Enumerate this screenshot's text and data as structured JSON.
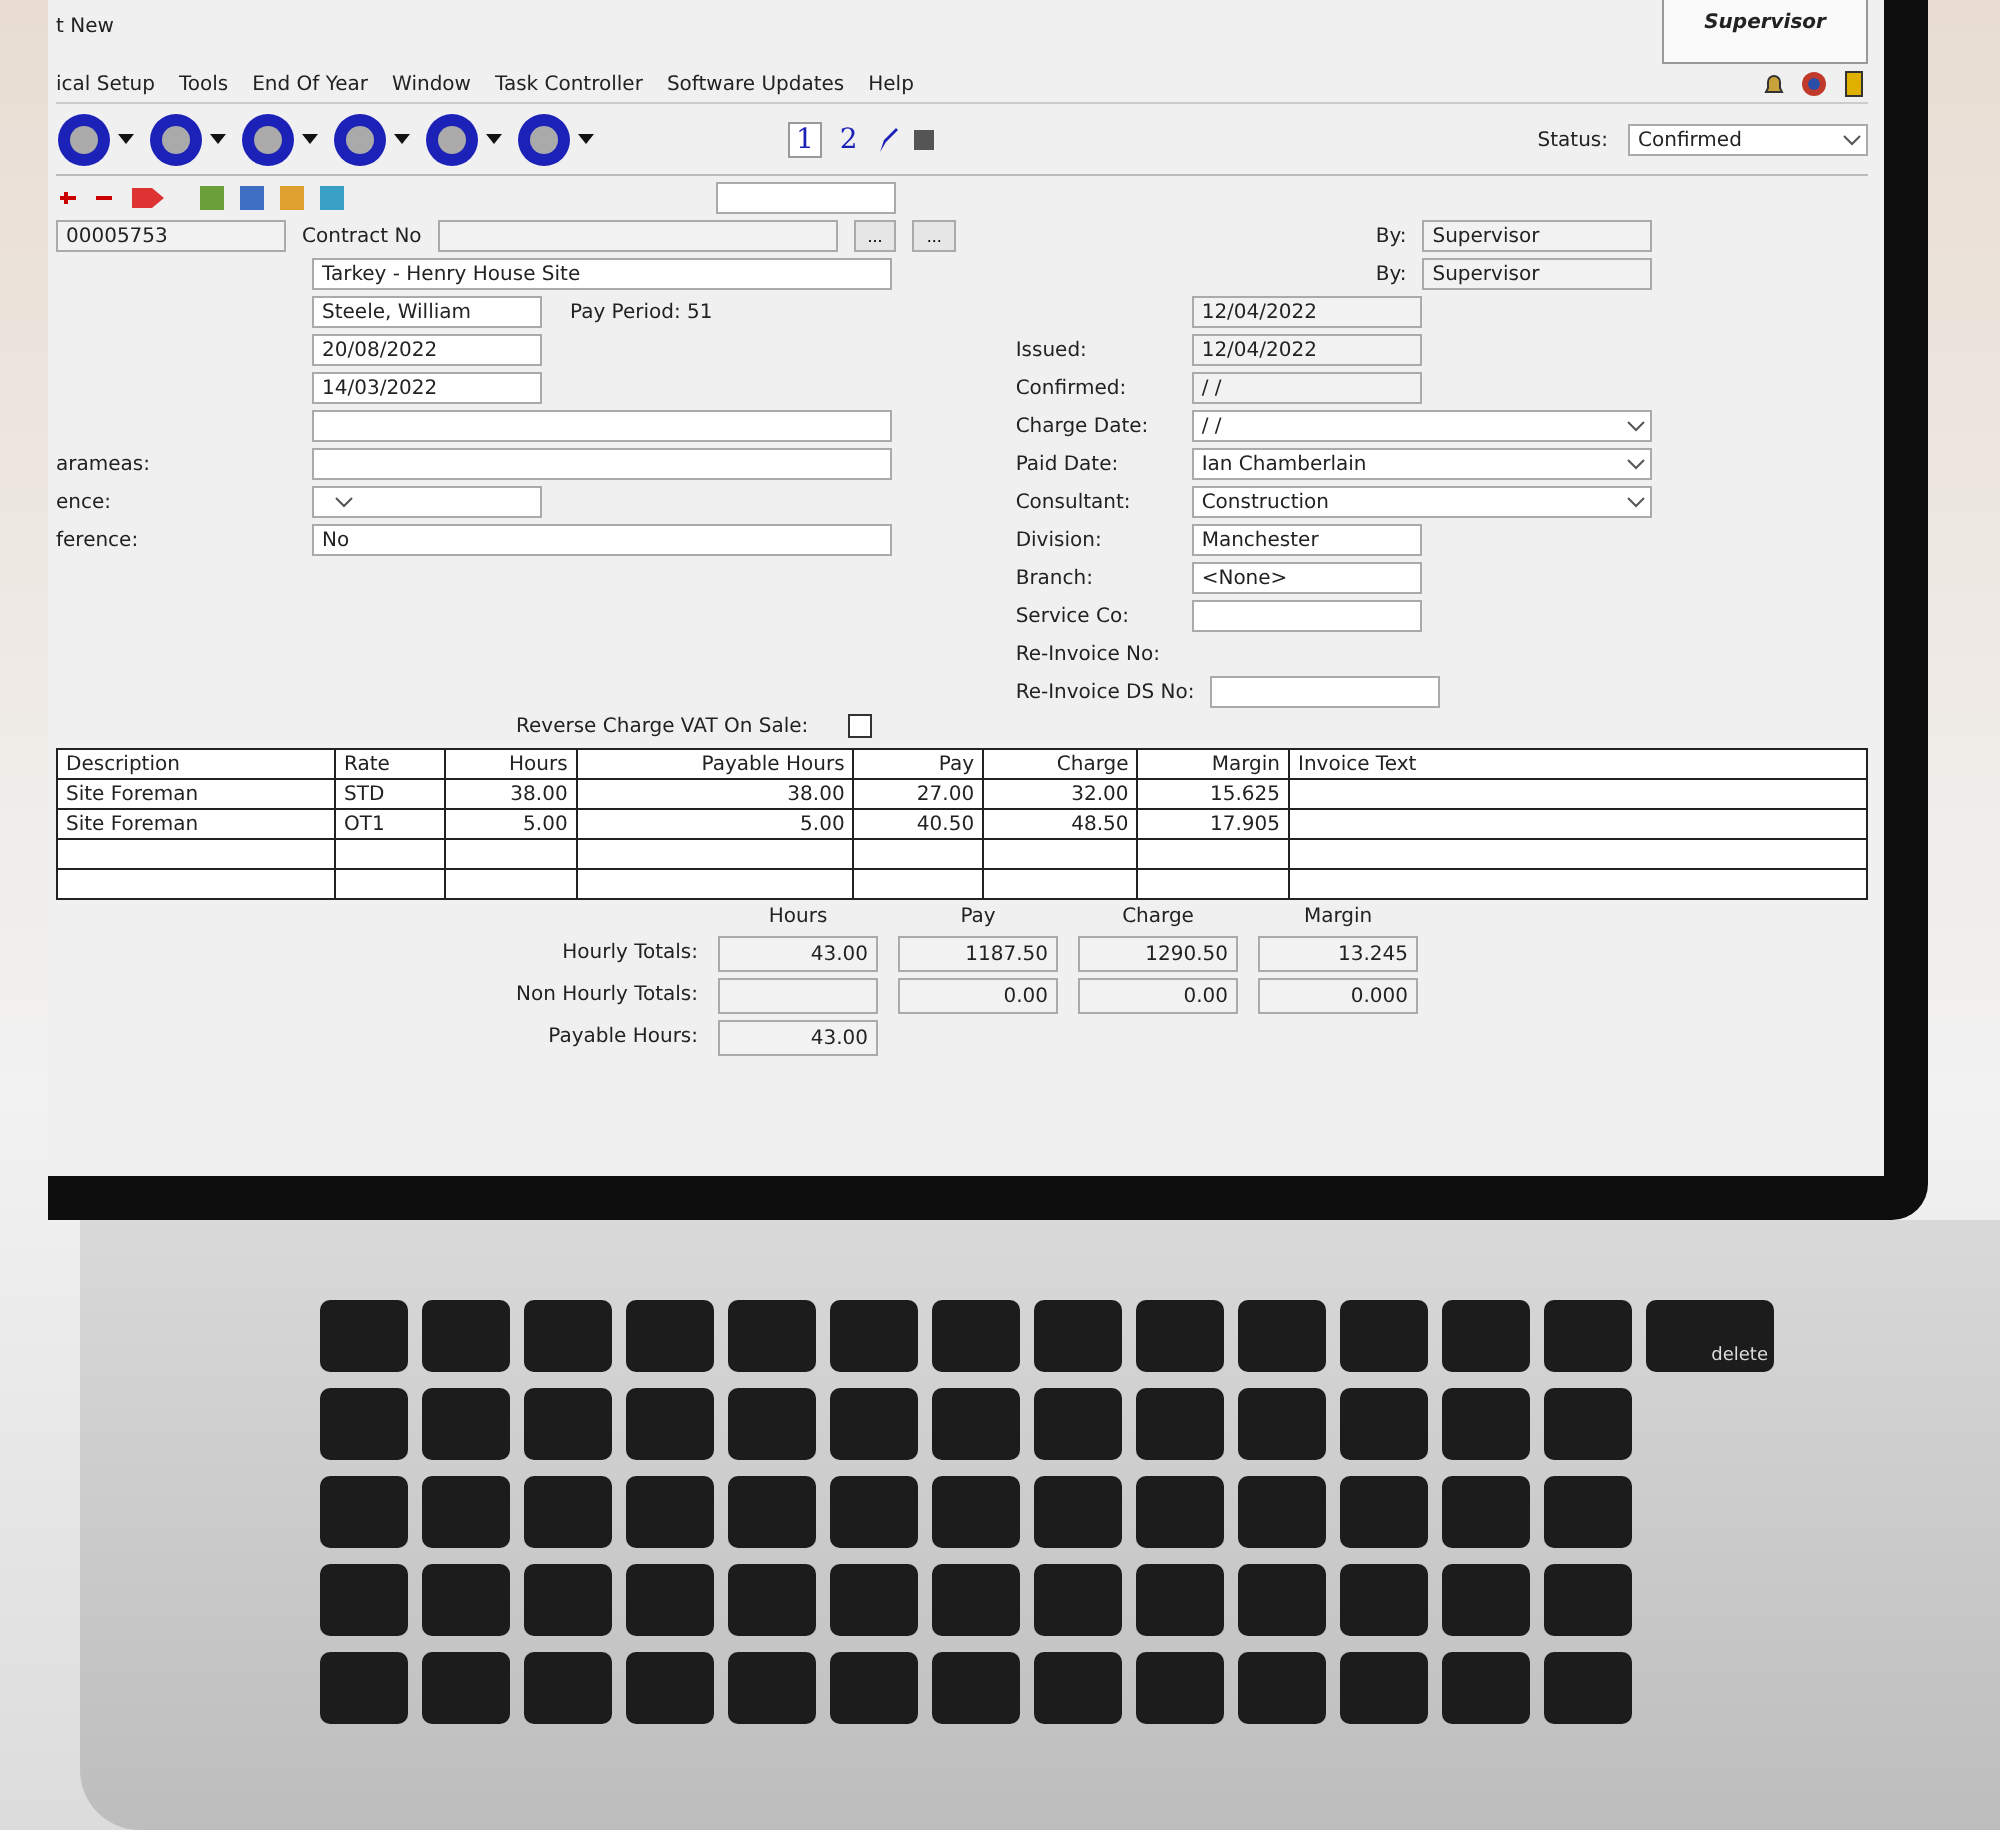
{
  "header": {
    "user": "Supervisor"
  },
  "title_fragment": "t New",
  "menu": [
    "ical Setup",
    "Tools",
    "End Of Year",
    "Window",
    "Task Controller",
    "Software Updates",
    "Help"
  ],
  "pages": [
    {
      "label": "1",
      "selected": true
    },
    {
      "label": "2",
      "selected": false
    }
  ],
  "status": {
    "label": "Status:",
    "value": "Confirmed"
  },
  "by": [
    {
      "label": "By:",
      "value": "Supervisor"
    },
    {
      "label": "By:",
      "value": "Supervisor"
    }
  ],
  "contract": {
    "label": "Contract No",
    "number": "00005753",
    "browse_buttons": [
      "...",
      "..."
    ]
  },
  "left_fields": [
    {
      "value": "Tarkey - Henry House Site",
      "kind": "text"
    },
    {
      "value": "Steele, William",
      "kind": "short",
      "note": "Pay Period: 51"
    },
    {
      "value": "20/08/2022",
      "kind": "short"
    },
    {
      "value": "14/03/2022",
      "kind": "short"
    },
    {
      "kind": "text"
    },
    {
      "label": "arameas:",
      "kind": "text"
    },
    {
      "label": "ence:",
      "kind": "select"
    },
    {
      "label": "ference:",
      "value": "No",
      "kind": "text"
    }
  ],
  "right_fields": [
    {
      "value": "12/04/2022",
      "kind": "readonly"
    },
    {
      "label": "Issued:",
      "value": "12/04/2022",
      "kind": "readonly"
    },
    {
      "label": "Confirmed:",
      "value": "/ /",
      "kind": "readonly"
    },
    {
      "label": "Charge Date:",
      "value": "/ /",
      "kind": "select"
    },
    {
      "label": "Paid Date:",
      "value": "Ian Chamberlain",
      "kind": "select"
    },
    {
      "label": "Consultant:",
      "value": "Construction",
      "kind": "select"
    },
    {
      "label": "Division:",
      "value": "Manchester",
      "kind": "text"
    },
    {
      "label": "Branch:",
      "value": "<None>",
      "kind": "text"
    },
    {
      "label": "Service Co:",
      "kind": "text"
    },
    {
      "label": "Re-Invoice No:",
      "kind": "none"
    }
  ],
  "reinvoice_ds": {
    "label": "Re-Invoice DS No:"
  },
  "reverse_charge": {
    "label": "Reverse Charge VAT On Sale:",
    "checked": false
  },
  "table": {
    "columns": [
      "Description",
      "Rate",
      "Hours",
      "Payable Hours",
      "Pay",
      "Charge",
      "Margin",
      "Invoice Text"
    ],
    "rows": [
      [
        "Site Foreman",
        "STD",
        "38.00",
        "38.00",
        "27.00",
        "32.00",
        "15.625"
      ],
      [
        "Site Foreman",
        "OT1",
        "5.00",
        "5.00",
        "40.50",
        "48.50",
        "17.905"
      ]
    ]
  },
  "totals": {
    "columns": [
      "Hours",
      "Pay",
      "Charge",
      "Margin"
    ],
    "rows": [
      {
        "label": "Hourly Totals:",
        "cells": [
          {
            "value": "43.00"
          },
          {
            "value": "1187.50"
          },
          {
            "value": "1290.50"
          },
          {
            "value": "13.245"
          }
        ]
      },
      {
        "label": "Non Hourly Totals:",
        "cells": [
          {
            "kind": "blank"
          },
          {
            "value": "0.00"
          },
          {
            "value": "0.00"
          },
          {
            "value": "0.000"
          }
        ]
      },
      {
        "label": "Payable Hours:",
        "cells": [
          {
            "value": "43.00"
          }
        ]
      }
    ]
  },
  "keyboard": {
    "key_label": "delete"
  }
}
